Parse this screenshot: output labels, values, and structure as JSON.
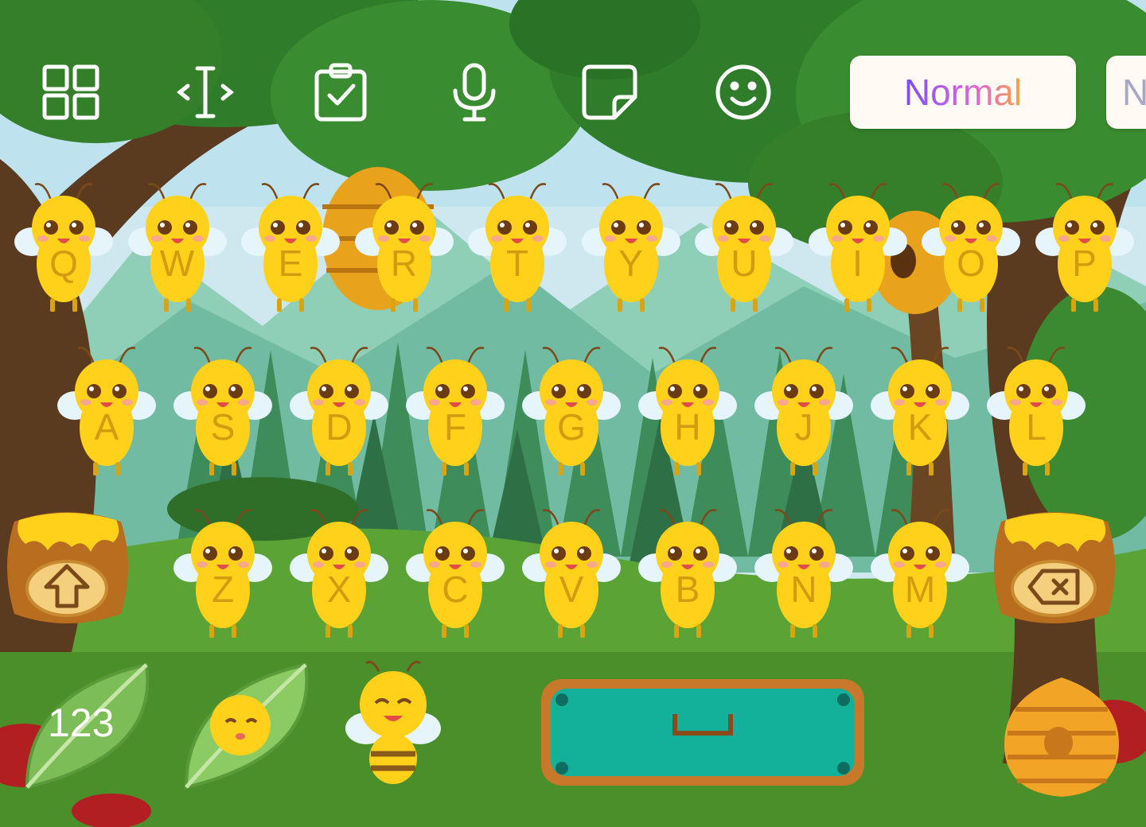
{
  "toolbar": {
    "icons": [
      "apps-grid-icon",
      "text-cursor-icon",
      "clipboard-icon",
      "microphone-icon",
      "sticker-icon",
      "emoji-icon"
    ],
    "styles": [
      "Normal",
      "N"
    ]
  },
  "keyboard": {
    "row1": [
      "Q",
      "W",
      "E",
      "R",
      "T",
      "Y",
      "U",
      "I",
      "O",
      "P"
    ],
    "row2": [
      "A",
      "S",
      "D",
      "F",
      "G",
      "H",
      "J",
      "K",
      "L"
    ],
    "row3": [
      "Z",
      "X",
      "C",
      "V",
      "B",
      "N",
      "M"
    ],
    "numbers_label": "123"
  },
  "colors": {
    "sky": "#cfe7ef",
    "mountain": "#8fcfb8",
    "foliage": "#2f7d2a",
    "grass": "#4f9a2a",
    "trunk": "#5a3b1f",
    "bee_yellow": "#ffd11a",
    "letter": "#d29b10",
    "space_key": "#13b09a",
    "space_frame": "#c8782a"
  }
}
